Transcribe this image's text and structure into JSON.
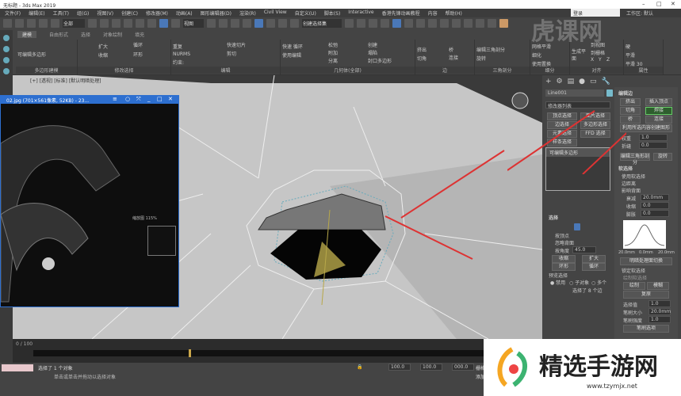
{
  "window": {
    "title": "无标题 - 3ds Max 2019",
    "search": "登录",
    "workspace_label": "工作区:",
    "workspace_value": "默认"
  },
  "menu": [
    "文件(F)",
    "编辑(E)",
    "工具(T)",
    "组(G)",
    "视图(V)",
    "创建(C)",
    "修改器(M)",
    "动画(A)",
    "图形编辑器(D)",
    "渲染(R)",
    "Civil View",
    "自定义(U)",
    "脚本(S)",
    "Interactive",
    "香港先锋动画教程",
    "内容",
    "帮助(H)"
  ],
  "toolbar": {
    "filter": "全部",
    "view": "视图",
    "selection_set": "创建选择集"
  },
  "ribbon": {
    "tabs": [
      "建模",
      "自由形式",
      "选择",
      "对象绘制",
      "填充"
    ],
    "panels": [
      {
        "label": "多边形建模",
        "items": [
          "可编辑多边形"
        ]
      },
      {
        "label": "修改选择",
        "items": [
          "扩大",
          "收缩",
          "循环",
          "环形"
        ]
      },
      {
        "label": "编辑",
        "items": [
          "重复",
          "快速切片",
          "NURMS",
          "剪切",
          "约束:"
        ]
      },
      {
        "label": "几何体(全部)",
        "items": [
          "快速 循环",
          "使用编辑",
          "松弛",
          "附加",
          "分离",
          "创建",
          "塌陷",
          "封口多边形"
        ]
      },
      {
        "label": "边",
        "items": [
          "桥",
          "挤出",
          "切角",
          "连接"
        ]
      },
      {
        "label": "三角剖分",
        "items": [
          "编辑三角剖分",
          "旋转"
        ]
      },
      {
        "label": "细分",
        "items": [
          "网格平滑",
          "细化",
          "使用置换"
        ]
      },
      {
        "label": "对齐",
        "items": [
          "生成平面",
          "到视图",
          "到栅格",
          "X",
          "Y",
          "Z"
        ]
      },
      {
        "label": "属性",
        "items": [
          "硬",
          "平滑",
          "平滑 30"
        ]
      }
    ]
  },
  "viewport": {
    "label": "[+] [透视] [标准] [默认明暗处理]"
  },
  "image_viewer": {
    "title": "02.jpg (701×561像素, 52KB) - 23...",
    "zoom_label": "缩放图 115%"
  },
  "command_panel": {
    "object_name": "Line001",
    "modifier_list": "修改器列表",
    "selection_buttons": [
      "顶点选择",
      "面片选择",
      "边选择",
      "多边形选择",
      "元素选择",
      "FFD 选择",
      "样条选择"
    ],
    "stack_item": "可编辑多边形",
    "selection": {
      "title": "选择",
      "by_vertex": "按顶点",
      "ignore_back": "忽略背面",
      "by_angle": "按角度",
      "angle": "45.0",
      "shrink": "收缩",
      "grow": "扩大",
      "ring": "环形",
      "loop": "循环",
      "preview": "预览选择",
      "preview_opts": [
        "禁用",
        "子对象",
        "多个"
      ],
      "status": "选择了 8 个边"
    },
    "edit_edges": {
      "title": "编辑边",
      "extrude": "挤出",
      "insert_vertex": "插入顶点",
      "chamfer": "切角",
      "weld": "焊接",
      "bridge": "桥",
      "connect": "连接",
      "create_shape": "利用所选内容创建图形",
      "weight": "权重",
      "crease": "折缝",
      "weight_val": "1.0",
      "crease_val": "0.0",
      "edit_tri": "编辑三角形剖分",
      "turn": "旋转"
    },
    "soft_selection": {
      "title": "软选择",
      "use": "使用软选择",
      "edge_dist": "边距离",
      "affect_back": "影响背面",
      "falloff": "衰减",
      "falloff_val": "20.0mm",
      "pinch": "收缩",
      "pinch_val": "0.0",
      "bubble": "膨胀",
      "bubble_val": "0.0",
      "axis": [
        "20.0mm",
        "0.0mm",
        "20.0mm"
      ],
      "shaded": "明暗处理面切换",
      "lock": "锁定软选择",
      "paint_soft": "绘制软选择",
      "paint": "绘制",
      "blur": "模糊",
      "revert": "复原",
      "sel_value": "选择值",
      "sel_value_val": "1.0",
      "brush_size": "笔刷大小",
      "brush_size_val": "20.0mm",
      "brush_strength": "笔刷强度",
      "brush_strength_val": "1.0",
      "brush_options": "笔刷选项"
    }
  },
  "timeline": {
    "frame": "0 / 100"
  },
  "status": {
    "selected": "选择了 1 个对象",
    "prompt": "单击或单击并拖动以选择对象",
    "x": "100.0",
    "y": "100.0",
    "z": "000.0",
    "grid": "栅格",
    "add_key": "添加时间标记"
  },
  "watermarks": {
    "top": "虎课网",
    "bottom": "精选手游网",
    "url": "www.tzymjx.net"
  }
}
